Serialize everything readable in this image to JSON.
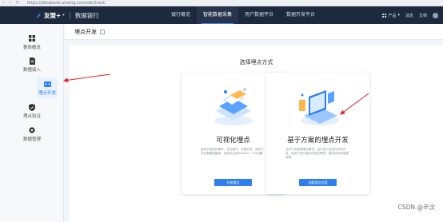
{
  "browser": {
    "url": "https://databank.umeng.com/sdc/track",
    "nav_glyphs": "‹ › ↻"
  },
  "header": {
    "brand": "友盟+",
    "brand_caret": "▾",
    "product": "数据银行",
    "nav": [
      {
        "label": "银行概览",
        "active": false
      },
      {
        "label": "智能数据采集",
        "active": true
      },
      {
        "label": "用户数据平台",
        "active": false
      },
      {
        "label": "数据开发平台",
        "active": false
      }
    ],
    "right": {
      "products_label": "产品",
      "products_caret": "▾",
      "help_label": "消息",
      "docs_label": "文档"
    }
  },
  "sidebar": {
    "items": [
      {
        "label": "整体概览",
        "icon": "grid-icon"
      },
      {
        "label": "数据接入",
        "icon": "document-icon"
      },
      {
        "label": "埋点开发",
        "icon": "code-icon",
        "active": true
      },
      {
        "label": "埋点验证",
        "icon": "shield-icon"
      },
      {
        "label": "数据管理",
        "icon": "gear-icon"
      }
    ]
  },
  "page": {
    "title": "埋点开发",
    "section_title": "选择埋点方式"
  },
  "cards": [
    {
      "title": "可视化埋点",
      "desc": "适用于按钮的事件、在页面内、无需开发。如有人员无需要接触库。目前也支持Android、iOS设置",
      "button": "开始埋点"
    },
    {
      "title": "基于方案的埋点开发",
      "desc": "业务人员整理埋点需求、由开发人员进行代码开发，适用于较为复杂的埋点需求，提供成功率高等效果",
      "button": "创建埋点方案"
    }
  ],
  "watermark": "CSDN @辛汶",
  "colors": {
    "topbar": "#1d2a3e",
    "accent": "#2f80ed",
    "annotation_arrow": "#e02424"
  }
}
